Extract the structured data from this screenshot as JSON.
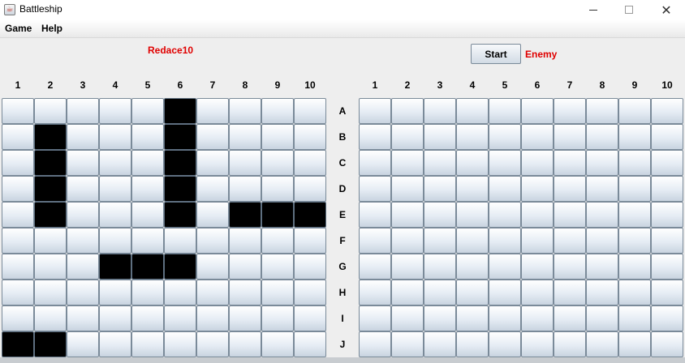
{
  "window": {
    "title": "Battleship",
    "icon": "java-cup-icon",
    "controls": {
      "minimize": "minimize-icon",
      "maximize": "maximize-icon",
      "close": "✕"
    }
  },
  "menu": {
    "items": [
      "Game",
      "Help"
    ]
  },
  "players": {
    "player_name": "Redace10",
    "enemy_name": "Enemy",
    "label_color": "#e00000"
  },
  "start_button": {
    "label": "Start"
  },
  "columns": [
    "1",
    "2",
    "3",
    "4",
    "5",
    "6",
    "7",
    "8",
    "9",
    "10"
  ],
  "rows": [
    "A",
    "B",
    "C",
    "D",
    "E",
    "F",
    "G",
    "H",
    "I",
    "J"
  ],
  "player_board": {
    "ship_cells": [
      "A6",
      "B2",
      "B6",
      "C2",
      "C6",
      "D2",
      "D6",
      "E2",
      "E6",
      "E8",
      "E9",
      "E10",
      "G4",
      "G5",
      "G6",
      "J1",
      "J2"
    ]
  },
  "enemy_board": {
    "ship_cells": []
  },
  "colors": {
    "ship": "#000000",
    "cell_border": "#7a8a99",
    "background": "#eeeeee"
  }
}
